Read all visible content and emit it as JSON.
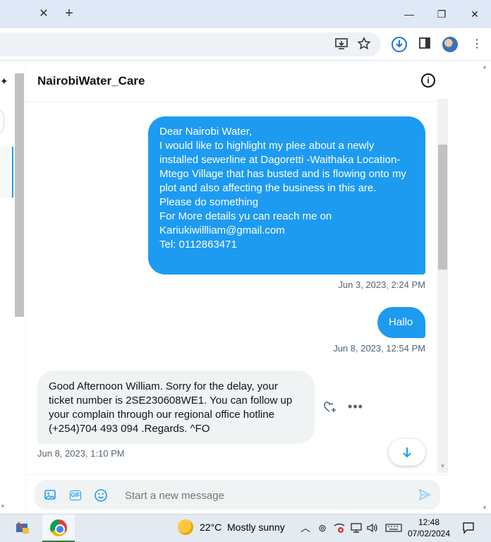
{
  "browser": {
    "tab_close_glyph": "✕",
    "new_tab_glyph": "+",
    "window_controls": {
      "minimize": "—",
      "restore": "❐",
      "close": "✕"
    },
    "toolbar_icons": [
      "install-app-icon",
      "star-icon",
      "download-icon",
      "sidepanel-icon",
      "profile-avatar",
      "kebab-menu-icon"
    ]
  },
  "header": {
    "title": "NairobiWater_Care",
    "info_glyph": "i"
  },
  "messages": [
    {
      "direction": "outgoing",
      "text": "Dear Nairobi Water,\nI would like to highlight my plee about a newly installed sewerline at Dagoretti  -Waithaka Location- Mtego Village that has busted and is flowing onto my plot and also affecting the business in this are.\nPlease do something\nFor More details yu can reach me on Kariukiwillliam@gmail.com\nTel: 0112863471",
      "timestamp": "Jun 3, 2023, 2:24 PM"
    },
    {
      "direction": "outgoing",
      "text": "Hallo",
      "timestamp": "Jun 8, 2023, 12:54 PM"
    },
    {
      "direction": "incoming",
      "text": "Good Afternoon William. Sorry for the delay, your ticket number is 2SE230608WE1. You can follow up your complain through our regional office hotline (+254)704 493 094 .Regards. ^FO",
      "timestamp": "Jun 8, 2023, 1:10 PM"
    }
  ],
  "composer": {
    "placeholder": "Start a new message",
    "gif_label": "GIF"
  },
  "taskbar": {
    "temperature": "22°C",
    "weather": "Mostly sunny",
    "time": "12:48",
    "date": "07/02/2024"
  },
  "colors": {
    "accent": "#1d9bf0",
    "incoming_bubble": "#eff3f4",
    "titlebar": "#dfe8f7"
  }
}
